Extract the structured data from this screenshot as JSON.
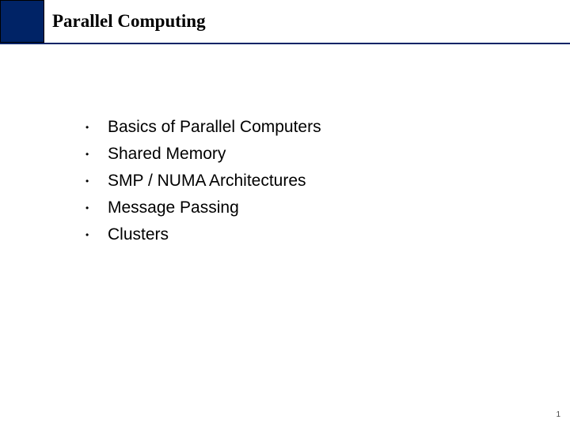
{
  "slide": {
    "title": "Parallel Computing",
    "bullets": [
      "Basics of Parallel Computers",
      "Shared Memory",
      "SMP / NUMA Architectures",
      "Message Passing",
      "Clusters"
    ],
    "page_number": "1"
  }
}
